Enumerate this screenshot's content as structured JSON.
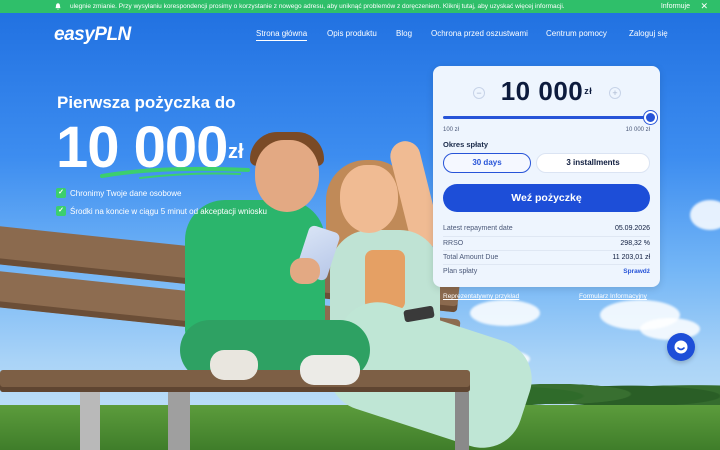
{
  "notice": {
    "message": "ulegnie zmianie. Przy wysyłaniu korespondencji prosimy o korzystanie z nowego adresu, aby uniknąć problemów z doręczeniem. Kliknij tutaj, aby uzyskać więcej informacji.",
    "info_label": "Informuje",
    "close_glyph": "✕",
    "icon": "bell-icon"
  },
  "header": {
    "logo": "easyPLN",
    "nav": [
      "Strona główna",
      "Opis produktu",
      "Blog",
      "Ochrona przed oszustwami",
      "Centrum pomocy",
      "Zaloguj się"
    ],
    "active_nav": "Strona główna"
  },
  "hero": {
    "title": "Pierwsza pożyczka do",
    "amount": "10 000",
    "unit": "zł",
    "features": [
      "Chronimy Twoje dane osobowe",
      "Środki na koncie w ciągu 5 minut od akceptacji wniosku"
    ]
  },
  "calculator": {
    "amount": "10 000",
    "unit": "zł",
    "minus": "−",
    "plus": "+",
    "slider_fraction": 1.0,
    "min_label": "100 zł",
    "max_label": "10 000 zł",
    "period_label": "Okres spłaty",
    "options": [
      "30 days",
      "3 installments"
    ],
    "selected_option": "30 days",
    "cta": "Weź pożyczkę",
    "details": [
      {
        "label": "Latest repayment date",
        "value": "05.09.2026"
      },
      {
        "label": "RRSO",
        "value": "298,32 %"
      },
      {
        "label": "Total Amount Due",
        "value": "11 203,01 zł"
      },
      {
        "label": "Plan spłaty",
        "value": "Sprawdź"
      }
    ]
  },
  "footer_links": [
    "Reprezentatywny przykład",
    "Formularz Informacyjny"
  ],
  "colors": {
    "notice_bg": "#2fbf6a",
    "primary": "#1d4ed8",
    "card_bg": "#eef5fe",
    "check": "#3ccf6e"
  }
}
